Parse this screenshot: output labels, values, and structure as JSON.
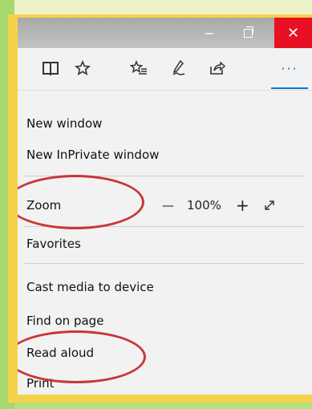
{
  "window": {
    "minimize_glyph": "−",
    "close_glyph": "✕"
  },
  "toolbar": {
    "icons": [
      "reading-view-icon",
      "favorite-star-icon",
      "favorites-hub-icon",
      "web-note-icon",
      "share-icon",
      "more-icon"
    ],
    "more_label": "···"
  },
  "menu": {
    "new_window": "New window",
    "new_inprivate_window": "New InPrivate window",
    "zoom_label": "Zoom",
    "zoom_minus": "—",
    "zoom_value": "100%",
    "zoom_plus": "+",
    "favorites": "Favorites",
    "cast_media": "Cast media to device",
    "find_on_page": "Find on page",
    "read_aloud": "Read aloud",
    "print": "Print"
  },
  "colors": {
    "close_button": "#e81123",
    "accent": "#0078d7",
    "annotation_circle": "#c8363a",
    "frame": "#f5d24c",
    "background": "#b4e07e"
  }
}
